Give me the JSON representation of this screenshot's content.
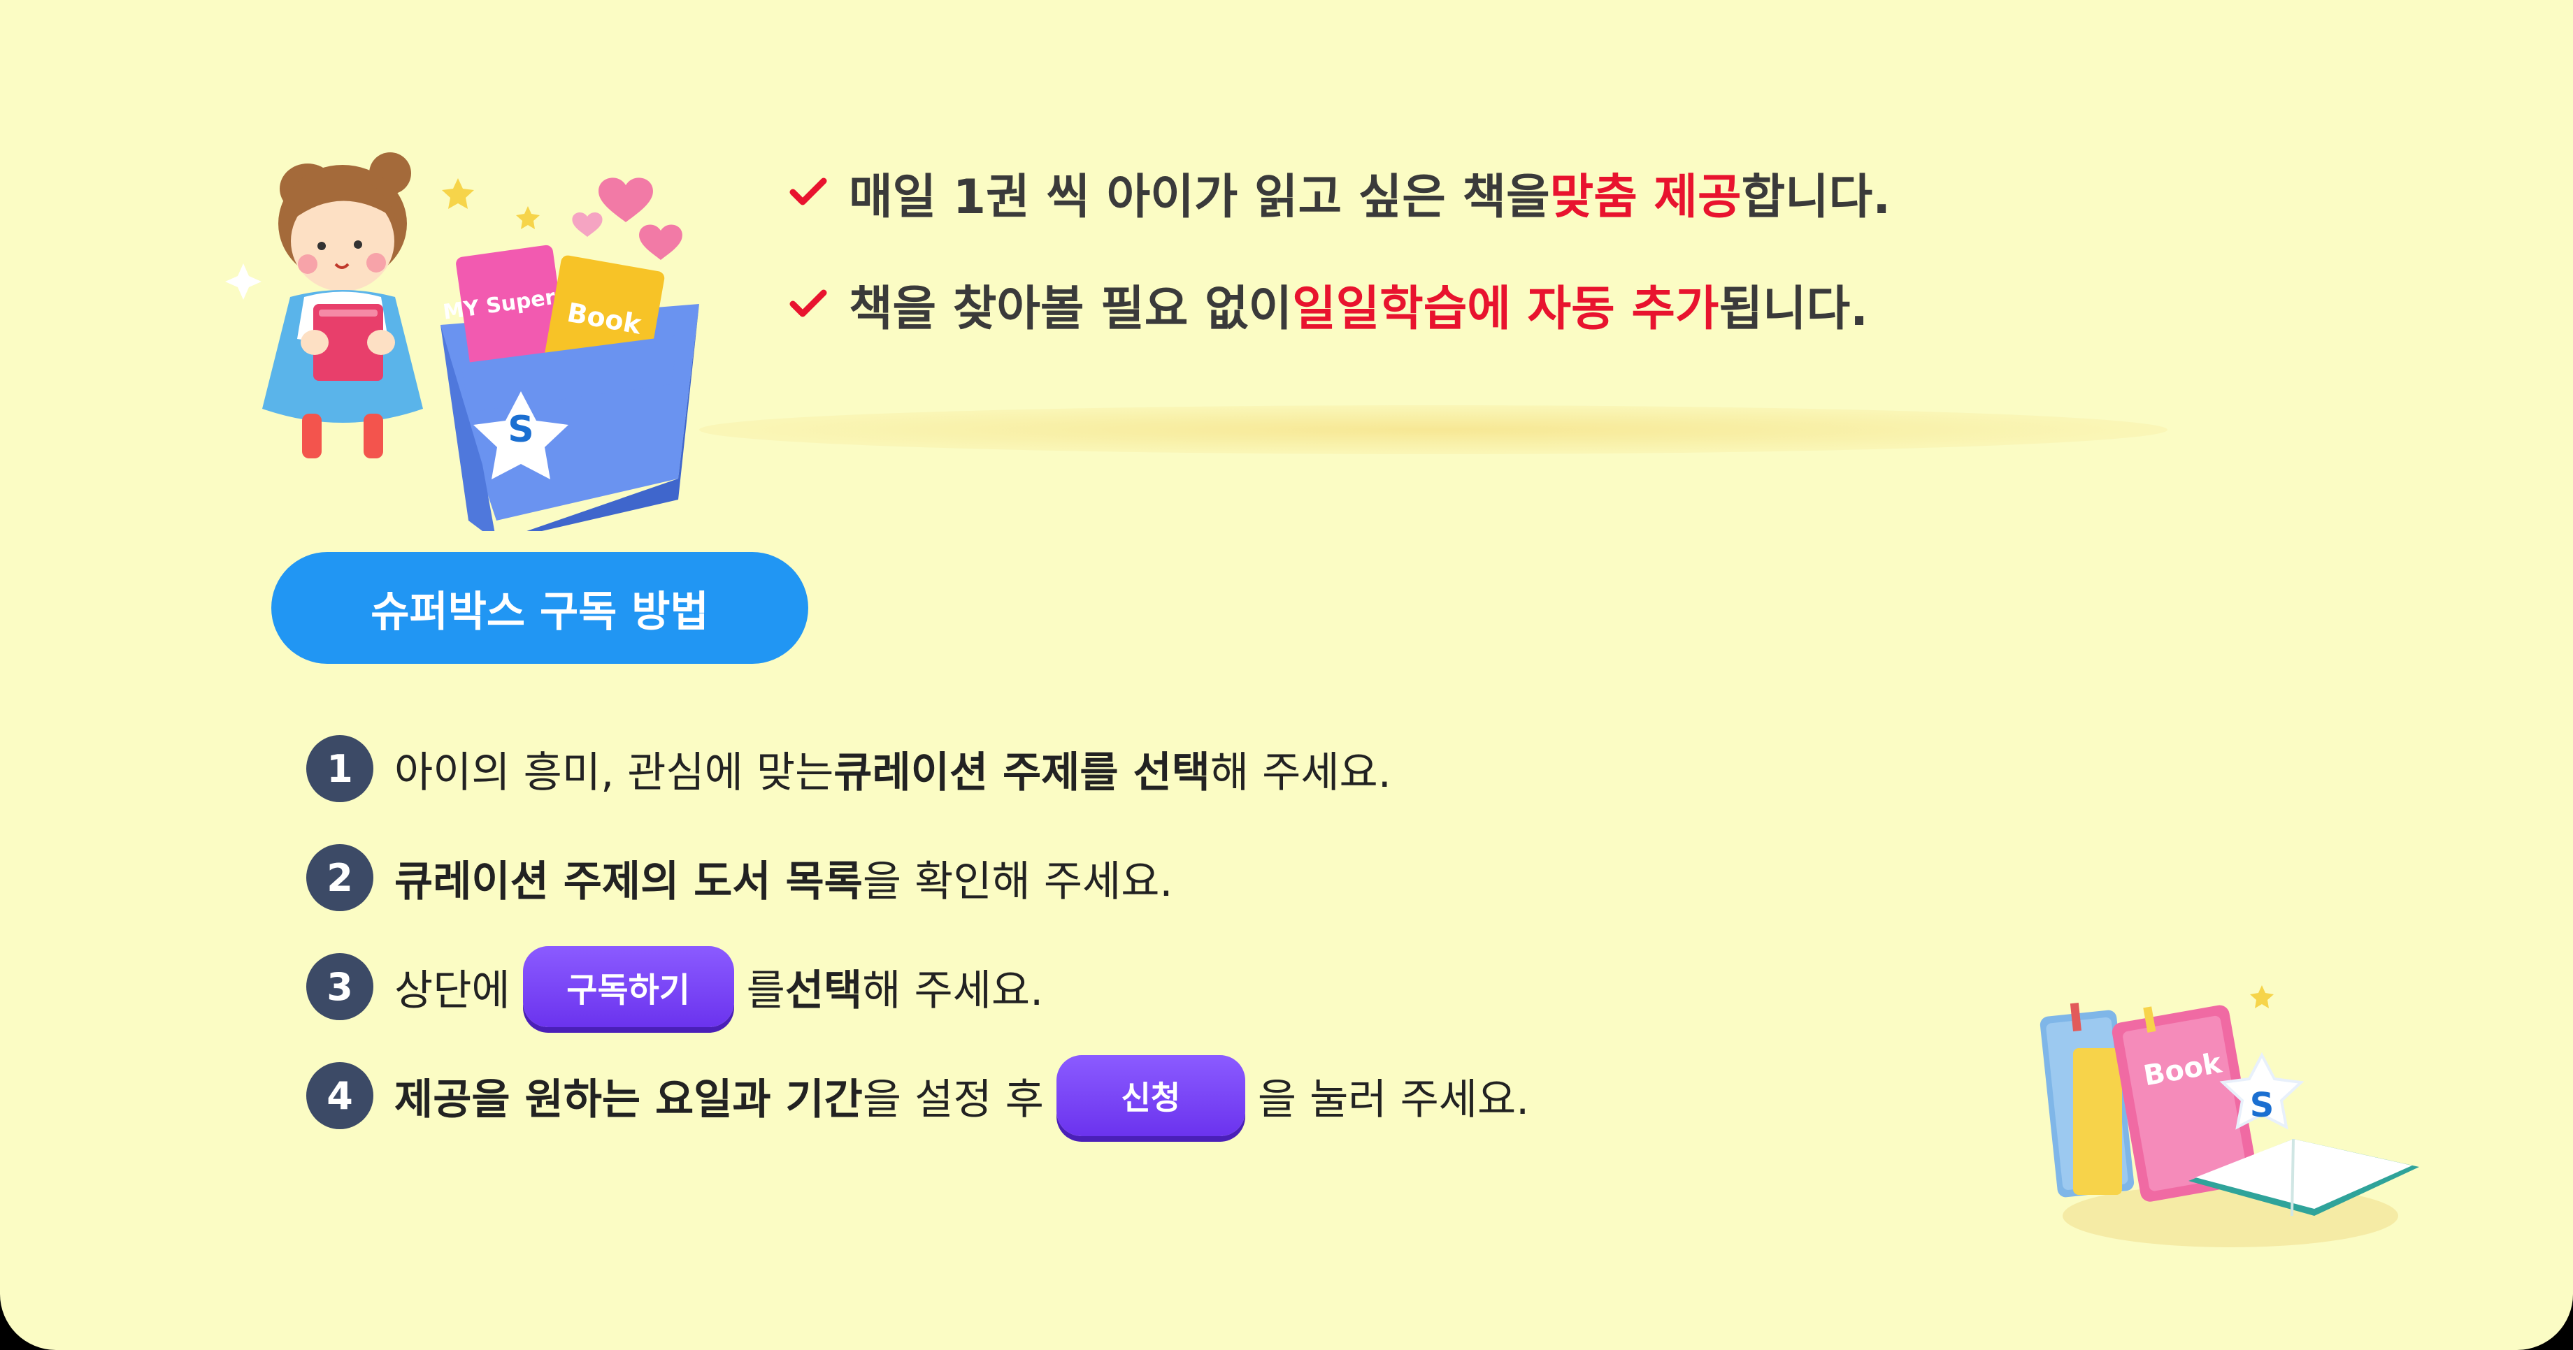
{
  "colors": {
    "background": "#fbfcc4",
    "accent_red": "#e8132e",
    "pill_blue": "#2196f3",
    "button_purple": "#6b33ee",
    "badge_navy": "#3c4a66"
  },
  "illustration_top": {
    "box_label_1": "MY Super V",
    "box_label_2": "Book",
    "emblem": "S"
  },
  "illustration_bottom": {
    "book_label": "Book",
    "emblem": "S"
  },
  "benefits": [
    {
      "icon": "check-icon",
      "pre": "매일 1권 씩 아이가 읽고 싶은 책을 ",
      "highlight": "맞춤 제공",
      "post": " 합니다."
    },
    {
      "icon": "check-icon",
      "pre": "책을 찾아볼 필요 없이 ",
      "highlight": "일일학습에 자동 추가",
      "post": " 됩니다."
    }
  ],
  "howto_title": "슈퍼박스 구독 방법",
  "steps": [
    {
      "num": "1",
      "a": "아이의 흥미, 관심에 맞는 ",
      "b": "큐레이션 주제를 선택",
      "c": "해 주세요."
    },
    {
      "num": "2",
      "a": "",
      "b": "큐레이션 주제의 도서 목록",
      "c": "을 확인해 주세요."
    },
    {
      "num": "3",
      "a": "상단에 ",
      "button": "구독하기",
      "b2": "를 ",
      "b": "선택",
      "c": "해 주세요."
    },
    {
      "num": "4",
      "b": "제공을 원하는 요일과 기간",
      "a": "을 설정 후 ",
      "button": "신청",
      "c": "을 눌러 주세요."
    }
  ]
}
